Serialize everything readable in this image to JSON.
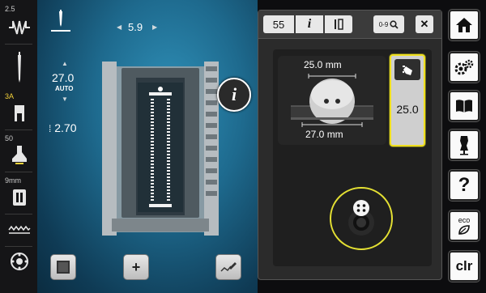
{
  "left_bar": {
    "stitch_width_label": "2.5",
    "needle_label": "3A",
    "presser_foot_label": "50",
    "feed_dog_label": "9mm"
  },
  "main": {
    "stitch_width_value": "5.9",
    "stitch_length_value": "27.0",
    "stitch_length_mode": "AUTO",
    "stitch_density_value": "2.70"
  },
  "popup": {
    "stitch_number": "55",
    "zoom_label": "0-9",
    "button_size_top": "25.0 mm",
    "button_size_bottom": "27.0 mm",
    "button_size_value": "25.0",
    "accent_color": "#f0df1f"
  },
  "right_bar": {
    "eco_label": "eco",
    "clr_label": "clr"
  }
}
